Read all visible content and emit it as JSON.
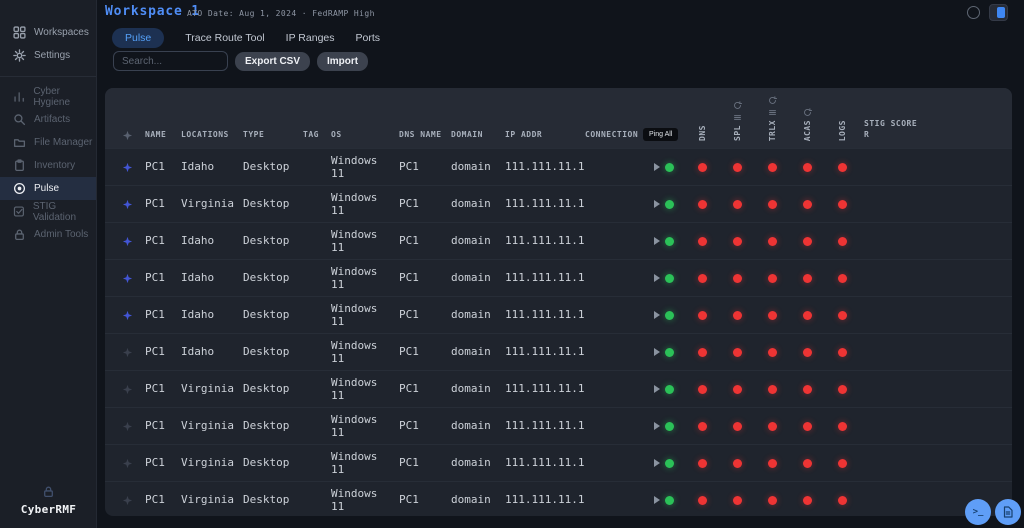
{
  "brand": {
    "name": "CyberRMF",
    "icon": "lock-icon"
  },
  "colors": {
    "accent": "#4f8df5",
    "green": "#2bc158",
    "red": "#ee3434",
    "tab_active_bg": "#1d3152",
    "select_blue": "#4356d6"
  },
  "header": {
    "workspace_title": "Workspace 1",
    "ato_text": "ATO Date: Aug 1, 2024 · FedRAMP High"
  },
  "top_right": {
    "status_icon": "status-circle-icon",
    "toggle_icon": "panel-toggle-icon"
  },
  "sidebar": {
    "top_items": [
      {
        "label": "Workspaces",
        "icon": "grid-icon"
      },
      {
        "label": "Settings",
        "icon": "gear-icon"
      }
    ],
    "menu_items": [
      {
        "label": "Cyber Hygiene",
        "icon": "chart-icon",
        "active": false
      },
      {
        "label": "Artifacts",
        "icon": "search-icon",
        "active": false
      },
      {
        "label": "File Manager",
        "icon": "folder-icon",
        "active": false
      },
      {
        "label": "Inventory",
        "icon": "clipboard-icon",
        "active": false
      },
      {
        "label": "Pulse",
        "icon": "radio-icon",
        "active": true
      },
      {
        "label": "STIG Validation",
        "icon": "check-square-icon",
        "active": false
      },
      {
        "label": "Admin Tools",
        "icon": "lock-icon",
        "active": false
      }
    ]
  },
  "tabs": [
    {
      "label": "Pulse",
      "active": true
    },
    {
      "label": "Trace Route Tool",
      "active": false
    },
    {
      "label": "IP Ranges",
      "active": false
    },
    {
      "label": "Ports",
      "active": false
    }
  ],
  "toolbar": {
    "search_placeholder": "Search...",
    "export_label": "Export CSV",
    "import_label": "Import"
  },
  "table": {
    "columns": [
      {
        "key": "select",
        "label": "",
        "icon": "sparkle-icon"
      },
      {
        "key": "name",
        "label": "NAME"
      },
      {
        "key": "locations",
        "label": "LOCATIONS"
      },
      {
        "key": "type",
        "label": "TYPE"
      },
      {
        "key": "tag",
        "label": "TAG"
      },
      {
        "key": "os",
        "label": "OS"
      },
      {
        "key": "dns_name",
        "label": "DNS NAME"
      },
      {
        "key": "domain",
        "label": "DOMAIN"
      },
      {
        "key": "ip_addr",
        "label": "IP ADDR"
      },
      {
        "key": "connection",
        "label": "CONNECTION"
      }
    ],
    "ping_all_label": "Ping All",
    "status_columns": [
      {
        "key": "dns",
        "label": "DNS",
        "icons": []
      },
      {
        "key": "spl",
        "label": "SPL",
        "icons": [
          "refresh-icon",
          "menu-icon"
        ]
      },
      {
        "key": "trlx",
        "label": "TRLX",
        "icons": [
          "refresh-icon",
          "menu-icon"
        ]
      },
      {
        "key": "acas",
        "label": "ACAS",
        "icons": [
          "refresh-icon"
        ]
      },
      {
        "key": "logs",
        "label": "LOGS",
        "icons": []
      }
    ],
    "stig_column_label": "STIG SCORE R",
    "rows": [
      {
        "selected": true,
        "name": "PC1",
        "locations": "Idaho",
        "type": "Desktop",
        "tag": "",
        "os": "Windows 11",
        "dns_name": "PC1",
        "domain": "domain",
        "ip_addr": "111.111.11.1",
        "connection": "online",
        "dns": "alert",
        "spl": "alert",
        "trlx": "alert",
        "acas": "alert",
        "logs": "alert",
        "stig_score": ""
      },
      {
        "selected": true,
        "name": "PC1",
        "locations": "Virginia",
        "type": "Desktop",
        "tag": "",
        "os": "Windows 11",
        "dns_name": "PC1",
        "domain": "domain",
        "ip_addr": "111.111.11.1",
        "connection": "online",
        "dns": "alert",
        "spl": "alert",
        "trlx": "alert",
        "acas": "alert",
        "logs": "alert",
        "stig_score": ""
      },
      {
        "selected": true,
        "name": "PC1",
        "locations": "Idaho",
        "type": "Desktop",
        "tag": "",
        "os": "Windows 11",
        "dns_name": "PC1",
        "domain": "domain",
        "ip_addr": "111.111.11.1",
        "connection": "online",
        "dns": "alert",
        "spl": "alert",
        "trlx": "alert",
        "acas": "alert",
        "logs": "alert",
        "stig_score": ""
      },
      {
        "selected": true,
        "name": "PC1",
        "locations": "Idaho",
        "type": "Desktop",
        "tag": "",
        "os": "Windows 11",
        "dns_name": "PC1",
        "domain": "domain",
        "ip_addr": "111.111.11.1",
        "connection": "online",
        "dns": "alert",
        "spl": "alert",
        "trlx": "alert",
        "acas": "alert",
        "logs": "alert",
        "stig_score": ""
      },
      {
        "selected": true,
        "name": "PC1",
        "locations": "Idaho",
        "type": "Desktop",
        "tag": "",
        "os": "Windows 11",
        "dns_name": "PC1",
        "domain": "domain",
        "ip_addr": "111.111.11.1",
        "connection": "online",
        "dns": "alert",
        "spl": "alert",
        "trlx": "alert",
        "acas": "alert",
        "logs": "alert",
        "stig_score": ""
      },
      {
        "selected": false,
        "name": "PC1",
        "locations": "Idaho",
        "type": "Desktop",
        "tag": "",
        "os": "Windows 11",
        "dns_name": "PC1",
        "domain": "domain",
        "ip_addr": "111.111.11.1",
        "connection": "online",
        "dns": "alert",
        "spl": "alert",
        "trlx": "alert",
        "acas": "alert",
        "logs": "alert",
        "stig_score": ""
      },
      {
        "selected": false,
        "name": "PC1",
        "locations": "Virginia",
        "type": "Desktop",
        "tag": "",
        "os": "Windows 11",
        "dns_name": "PC1",
        "domain": "domain",
        "ip_addr": "111.111.11.1",
        "connection": "online",
        "dns": "alert",
        "spl": "alert",
        "trlx": "alert",
        "acas": "alert",
        "logs": "alert",
        "stig_score": ""
      },
      {
        "selected": false,
        "name": "PC1",
        "locations": "Virginia",
        "type": "Desktop",
        "tag": "",
        "os": "Windows 11",
        "dns_name": "PC1",
        "domain": "domain",
        "ip_addr": "111.111.11.1",
        "connection": "online",
        "dns": "alert",
        "spl": "alert",
        "trlx": "alert",
        "acas": "alert",
        "logs": "alert",
        "stig_score": ""
      },
      {
        "selected": false,
        "name": "PC1",
        "locations": "Virginia",
        "type": "Desktop",
        "tag": "",
        "os": "Windows 11",
        "dns_name": "PC1",
        "domain": "domain",
        "ip_addr": "111.111.11.1",
        "connection": "online",
        "dns": "alert",
        "spl": "alert",
        "trlx": "alert",
        "acas": "alert",
        "logs": "alert",
        "stig_score": ""
      },
      {
        "selected": false,
        "name": "PC1",
        "locations": "Virginia",
        "type": "Desktop",
        "tag": "",
        "os": "Windows 11",
        "dns_name": "PC1",
        "domain": "domain",
        "ip_addr": "111.111.11.1",
        "connection": "online",
        "dns": "alert",
        "spl": "alert",
        "trlx": "alert",
        "acas": "alert",
        "logs": "alert",
        "stig_score": ""
      }
    ]
  },
  "fabs": [
    {
      "icon": "terminal-icon"
    },
    {
      "icon": "document-icon"
    }
  ]
}
